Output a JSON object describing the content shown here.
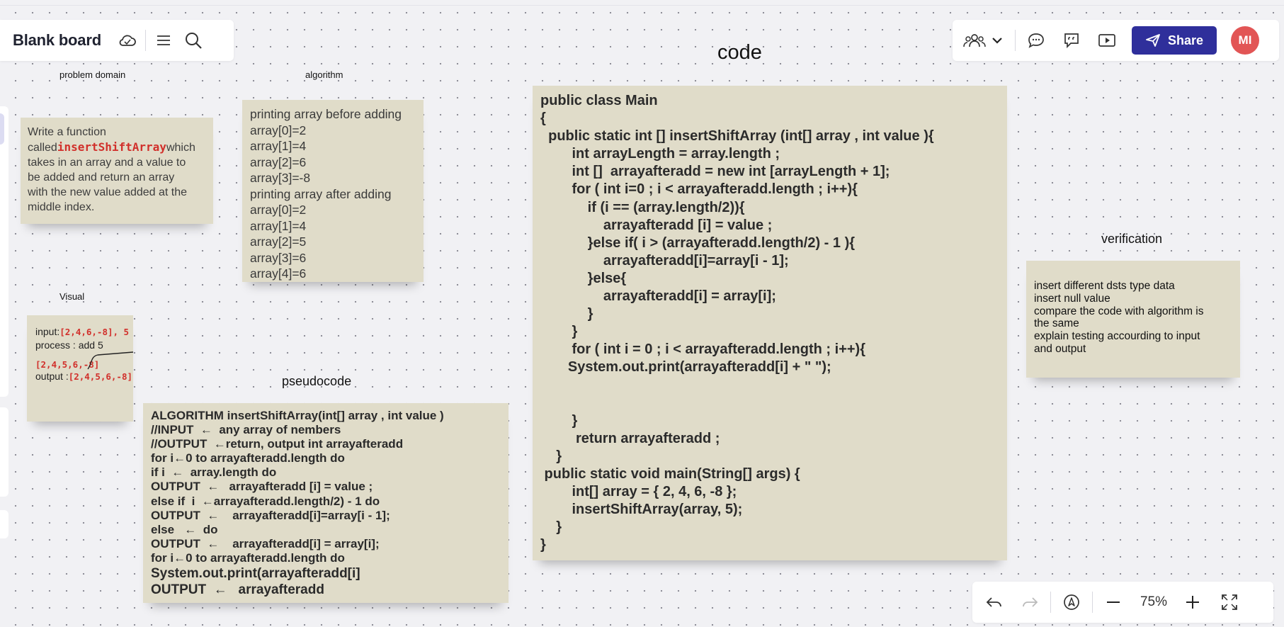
{
  "board": {
    "title": "Blank board"
  },
  "toolbar": {
    "share_label": "Share",
    "avatar_initials": "MI",
    "zoom_level": "75%"
  },
  "colors": {
    "accent": "#2f2f9b",
    "avatar": "#e25555",
    "note": "#e0dcc9",
    "highlight": "#d1302b"
  },
  "labels": {
    "problem_domain": "problem domain",
    "algorithm": "algorithm",
    "code": "code",
    "verification": "verification",
    "visual": "Visual",
    "pseudocode": "pseudocode"
  },
  "problem_note": {
    "line1": "Write a function",
    "called_prefix": "called",
    "function_name": "insertShiftArray",
    "called_suffix": "which",
    "rest": [
      "takes in an array and a value to",
      "be added and return an array",
      "with the new value added at the",
      "middle index."
    ]
  },
  "algorithm_note": {
    "lines": [
      "printing array before adding",
      "array[0]=2",
      "array[1]=4",
      "array[2]=6",
      "array[3]=-8",
      "printing array after adding",
      "array[0]=2",
      "array[1]=4",
      "array[2]=5",
      "array[3]=6",
      "array[4]=6"
    ]
  },
  "visual_note": {
    "input_label": "input:",
    "input_value": "[2,4,6,-8], 5",
    "process": "process : add 5",
    "result": "[2,4,5,6,-8]",
    "output_label": "output :",
    "output_value": "[2,4,5,6,-8]"
  },
  "pseudocode_note": {
    "lines": [
      "ALGORITHM insertShiftArray(int[] array , int value )",
      "//INPUT  ←  any array of nembers",
      "//OUTPUT  ←return, output int arrayafteradd",
      "for i←0 to arrayafteradd.length do",
      "if i  ←  array.length do",
      "OUTPUT  ←   arrayafteradd [i] = value ;",
      "else if  i  ←arrayafteradd.length/2) - 1 do",
      "OUTPUT  ←    arrayafteradd[i]=array[i - 1];",
      "else   ←  do",
      "OUTPUT  ←    arrayafteradd[i] = array[i];",
      "for i←0 to arrayafteradd.length do",
      "System.out.print(arrayafteradd[i]",
      "OUTPUT  ←   arrayafteradd"
    ]
  },
  "code_note": {
    "lines": [
      "public class Main",
      "{",
      "  public static int [] insertShiftArray (int[] array , int value ){",
      "        int arrayLength = array.length ;",
      "        int []  arrayafteradd = new int [arrayLength + 1];",
      "        for ( int i=0 ; i < arrayafteradd.length ; i++){",
      "            if (i == (array.length/2)){",
      "                arrayafteradd [i] = value ;",
      "            }else if( i > (arrayafteradd.length/2) - 1 ){",
      "                arrayafteradd[i]=array[i - 1];",
      "            }else{",
      "                arrayafteradd[i] = array[i];",
      "            }",
      "        }",
      "        for ( int i = 0 ; i < arrayafteradd.length ; i++){",
      "       System.out.print(arrayafteradd[i] + \" \");",
      "",
      "",
      "        }",
      "         return arrayafteradd ;",
      "    }",
      " public static void main(String[] args) {",
      "        int[] array = { 2, 4, 6, -8 };",
      "        insertShiftArray(array, 5);",
      "    }",
      "}"
    ]
  },
  "verification_note": {
    "lines": [
      "insert different dsts type data",
      "insert null value",
      "compare the code with algorithm is",
      "the same",
      "explain testing accourding to input",
      "and output"
    ]
  }
}
